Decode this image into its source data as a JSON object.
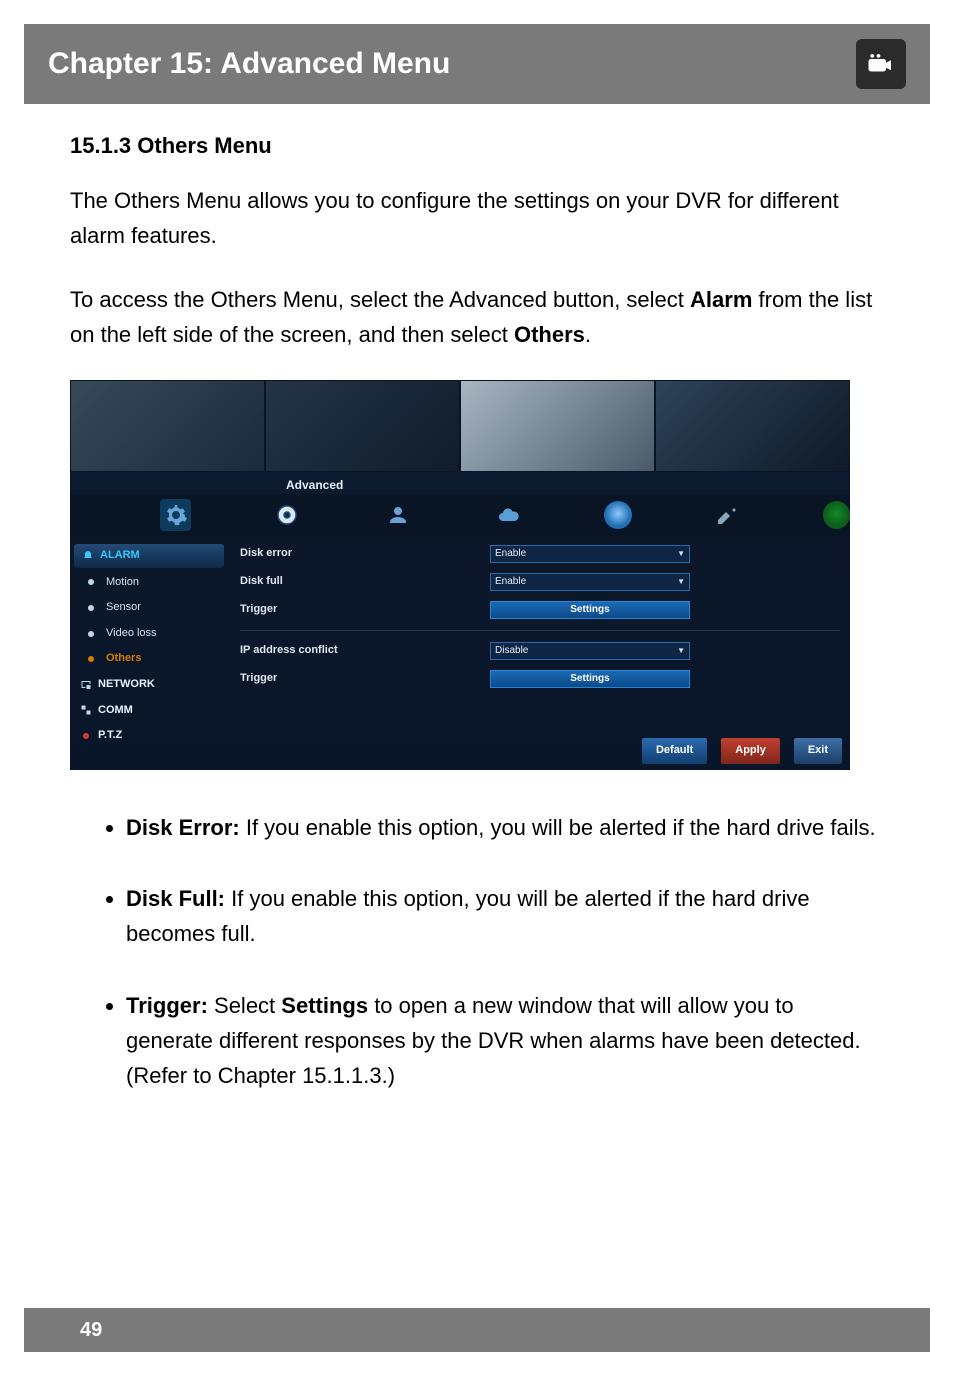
{
  "header": {
    "title": "Chapter 15: Advanced Menu"
  },
  "section": {
    "heading": "15.1.3 Others Menu"
  },
  "para1": "The Others Menu allows you to configure the settings on your DVR for different alarm features.",
  "para2a": "To access the Others Menu, select the Advanced button, select ",
  "para2b": "Alarm",
  "para2c": " from the list on the left side of the screen, and then select ",
  "para2d": "Others",
  "para2e": ".",
  "screenshot": {
    "advanced_label": "Advanced",
    "sidebar": {
      "alarm_header": "ALARM",
      "items": [
        "Motion",
        "Sensor",
        "Video loss",
        "Others"
      ],
      "network": "NETWORK",
      "comm": "COMM",
      "ptz": "P.T.Z"
    },
    "config": {
      "disk_error_label": "Disk error",
      "disk_error_value": "Enable",
      "disk_full_label": "Disk full",
      "disk_full_value": "Enable",
      "trigger1_label": "Trigger",
      "settings1": "Settings",
      "ip_conflict_label": "IP address conflict",
      "ip_conflict_value": "Disable",
      "trigger2_label": "Trigger",
      "settings2": "Settings"
    },
    "footer": {
      "default": "Default",
      "apply": "Apply",
      "exit": "Exit"
    }
  },
  "bullets": [
    {
      "title": "Disk Error:",
      "body": " If you enable this option, you will be alerted if the hard drive fails."
    },
    {
      "title": "Disk Full:",
      "body": " If you enable this option, you will be alerted if the hard drive becomes full."
    },
    {
      "title": "Trigger:",
      "body_a": " Select ",
      "body_b": "Settings",
      "body_c": " to open a new window that will allow you to generate different responses by the DVR when alarms have been detected. (Refer to Chapter 15.1.1.3.)"
    }
  ],
  "page_number": "49"
}
